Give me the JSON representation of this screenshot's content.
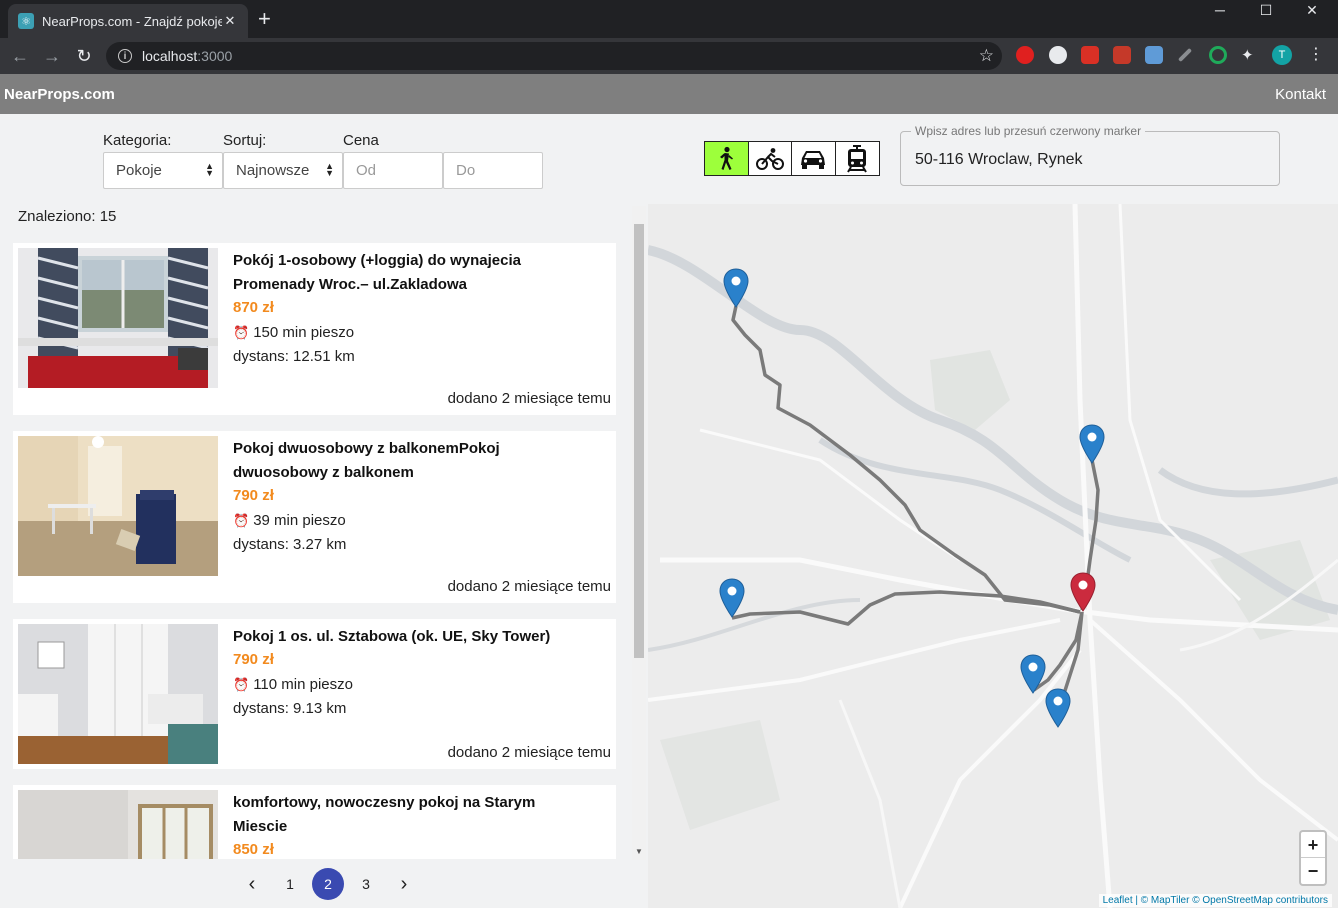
{
  "browser": {
    "tab_title": "NearProps.com - Znajdź pokoje I",
    "tab_close": "✕",
    "new_tab": "+",
    "url_host": "localhost",
    "url_port": ":3000",
    "profile_initial": "T",
    "window_controls": [
      "─",
      "☐",
      "✕"
    ]
  },
  "header": {
    "brand": "NearProps.com",
    "contact": "Kontakt"
  },
  "filters": {
    "category_label": "Kategoria:",
    "category_value": "Pokoje",
    "sort_label": "Sortuj:",
    "sort_value": "Najnowsze",
    "price_label": "Cena",
    "price_from_placeholder": "Od",
    "price_to_placeholder": "Do"
  },
  "transport_modes": [
    {
      "name": "walk-icon",
      "active": true
    },
    {
      "name": "bike-icon",
      "active": false
    },
    {
      "name": "car-icon",
      "active": false
    },
    {
      "name": "tram-icon",
      "active": false
    }
  ],
  "address": {
    "legend": "Wpisz adres lub przesuń czerwony marker",
    "value": "50-116 Wroclaw, Rynek"
  },
  "results": {
    "found": "Znaleziono: 15"
  },
  "listings": [
    {
      "title": "Pokój 1-osobowy (+loggia) do wynajecia Promenady Wroc.– ul.Zakladowa",
      "price": "870 zł",
      "time": "150 min pieszo",
      "distance": "dystans: 12.51 km",
      "added": "dodano 2 miesiące temu"
    },
    {
      "title": "Pokoj dwuosobowy z balkonemPokoj dwuosobowy z balkonem",
      "price": "790 zł",
      "time": "39 min pieszo",
      "distance": "dystans: 3.27 km",
      "added": "dodano 2 miesiące temu"
    },
    {
      "title": "Pokoj 1 os. ul. Sztabowa (ok. UE, Sky Tower)",
      "price": "790 zł",
      "time": "110 min pieszo",
      "distance": "dystans: 9.13 km",
      "added": "dodano 2 miesiące temu"
    },
    {
      "title": "komfortowy, nowoczesny pokoj na Starym Miescie",
      "price": "850 zł"
    }
  ],
  "pagination": {
    "prev": "‹",
    "pages": [
      "1",
      "2",
      "3"
    ],
    "current": "2",
    "next": "›"
  },
  "map": {
    "zoom_in": "+",
    "zoom_out": "−",
    "attribution_leaflet": "Leaflet",
    "attribution_rest": " | © MapTiler © OpenStreetMap contributors"
  },
  "colors": {
    "accent_price": "#f28a1e",
    "active_mode": "#9dff3b",
    "pager_active": "#3a4ab1",
    "marker_blue": "#2a81cb",
    "marker_red": "#cb2b3e"
  }
}
